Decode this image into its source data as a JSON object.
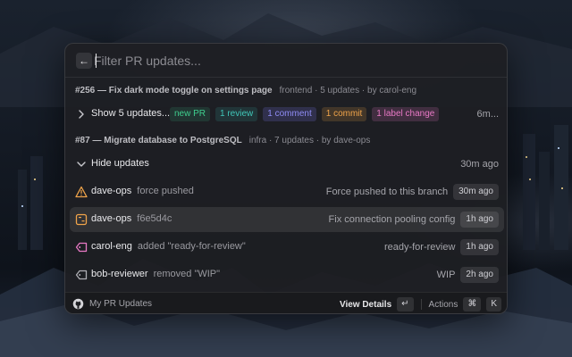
{
  "search": {
    "placeholder": "Filter PR updates...",
    "back_icon": "arrow-left-icon"
  },
  "groups": [
    {
      "header": {
        "title": "#256 — Fix dark mode toggle on settings page",
        "meta": "frontend · 5 updates · by carol-eng"
      },
      "summary_row": {
        "label": "Show 5 updates...",
        "icon": "chevron-right-icon",
        "tags": [
          {
            "label": "new PR",
            "color": "#3fcf8e"
          },
          {
            "label": "1 review",
            "color": "#41c7b9"
          },
          {
            "label": "1 comment",
            "color": "#8f8cf5"
          },
          {
            "label": "1 commit",
            "color": "#f0a44a"
          },
          {
            "label": "1 label change",
            "color": "#e879c5"
          }
        ],
        "time": "6m..."
      }
    },
    {
      "header": {
        "title": "#87 — Migrate database to PostgreSQL",
        "meta": "infra · 7 updates · by dave-ops"
      },
      "summary_row": {
        "label": "Hide updates",
        "icon": "chevron-down-icon",
        "time": "30m ago"
      },
      "items": [
        {
          "icon": "warning-triangle-icon",
          "icon_color": "#f0a44a",
          "user": "dave-ops",
          "action": "force pushed",
          "detail": "Force pushed to this branch",
          "time": "30m ago",
          "selected": false
        },
        {
          "icon": "commit-icon",
          "icon_color": "#f0a44a",
          "user": "dave-ops",
          "action": "f6e5d4c",
          "detail": "Fix connection pooling config",
          "time": "1h ago",
          "selected": true
        },
        {
          "icon": "tag-icon",
          "icon_color": "#e879c5",
          "user": "carol-eng",
          "action": "added \"ready-for-review\"",
          "detail": "ready-for-review",
          "time": "1h ago",
          "selected": false
        },
        {
          "icon": "tag-icon",
          "icon_color": "#b0b0b6",
          "user": "bob-reviewer",
          "action": "removed \"WIP\"",
          "detail": "WIP",
          "time": "2h ago",
          "selected": false
        }
      ]
    }
  ],
  "footer": {
    "app_icon": "github-icon",
    "title": "My PR Updates",
    "primary_action": "View Details",
    "primary_key": "↵",
    "actions_label": "Actions",
    "actions_key_mod": "⌘",
    "actions_key": "K"
  }
}
